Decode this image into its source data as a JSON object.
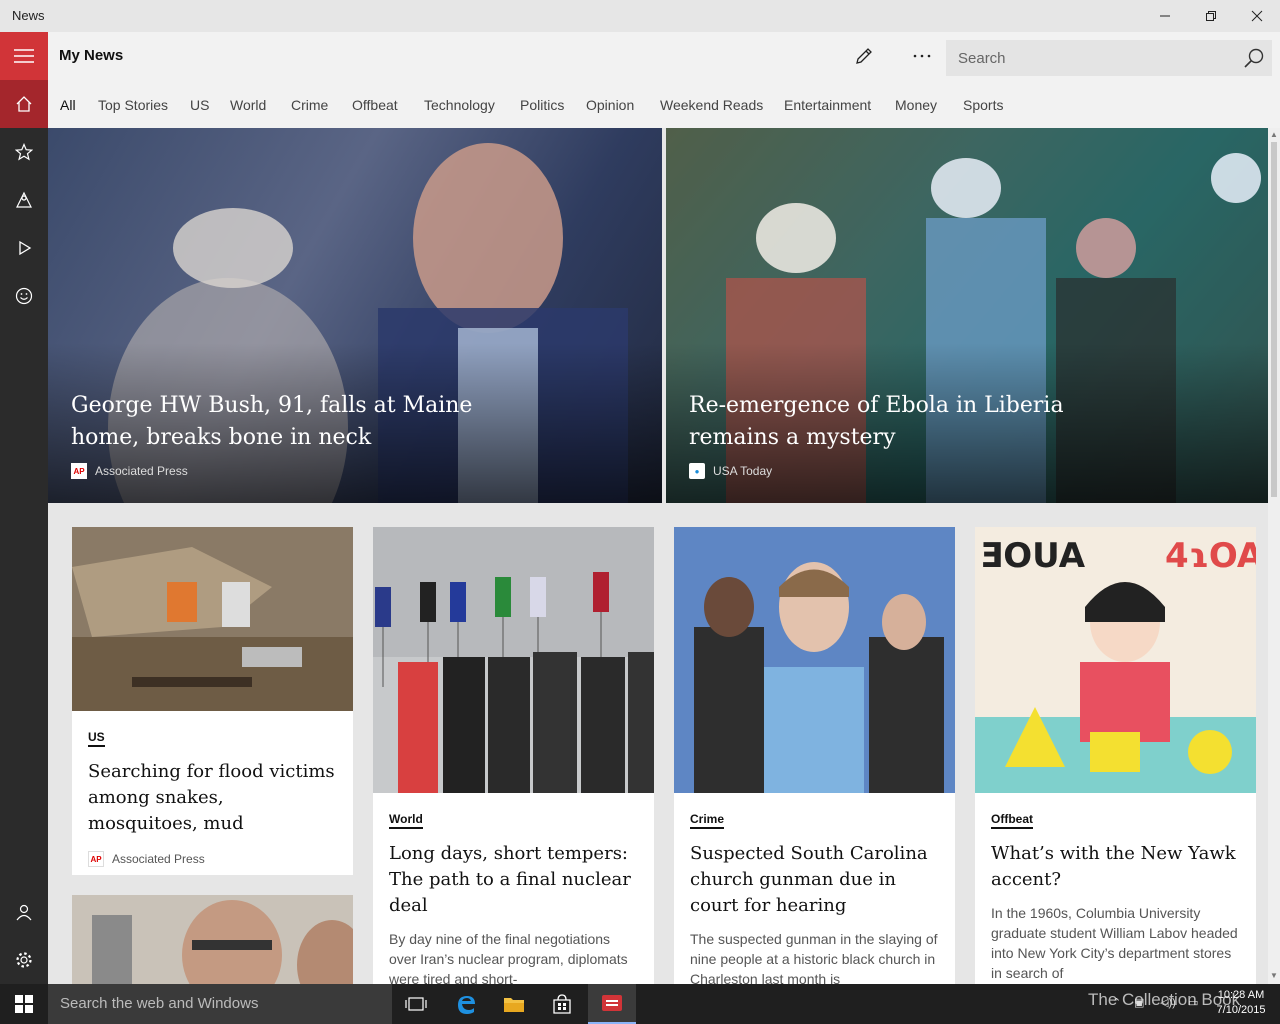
{
  "window": {
    "title": "News"
  },
  "header": {
    "page_title": "My News"
  },
  "search": {
    "placeholder": "Search"
  },
  "tabs": [
    "All",
    "Top Stories",
    "US",
    "World",
    "Crime",
    "Offbeat",
    "Technology",
    "Politics",
    "Opinion",
    "Weekend Reads",
    "Entertainment",
    "Money",
    "Sports"
  ],
  "hero": [
    {
      "headline": "George HW Bush, 91, falls at Maine home, breaks bone in neck",
      "source": "Associated Press",
      "source_icon": "AP"
    },
    {
      "headline": "Re-emergence of Ebola in Liberia remains a mystery",
      "source": "USA Today",
      "source_icon": "usa-today-icon"
    }
  ],
  "cards": [
    {
      "category": "US",
      "title": "Searching for flood victims among snakes, mosquitoes, mud",
      "source": "Associated Press",
      "source_icon": "AP"
    },
    {
      "category": "World",
      "title": "Long days, short tempers: The path to a final nuclear deal",
      "summary": "By day nine of the final negotiations over Iran’s nuclear program, diplomats were tired and short-"
    },
    {
      "category": "Crime",
      "title": "Suspected South Carolina church gunman due in court for hearing",
      "summary": "The suspected gunman in the slaying of nine people at a historic black church in Charleston last month is"
    },
    {
      "category": "Offbeat",
      "title": "What’s with the New Yawk accent?",
      "summary": "In the 1960s, Columbia University graduate student William Labov headed into New York City’s department stores in search of"
    }
  ],
  "taskbar": {
    "search_placeholder": "Search the web and Windows",
    "time": "10:28 AM",
    "date": "7/10/2015",
    "watermark": "The Collection Book"
  },
  "colors": {
    "accent": "#d13438",
    "accent_dark": "#a4262c",
    "rail": "#2b2b2b"
  }
}
